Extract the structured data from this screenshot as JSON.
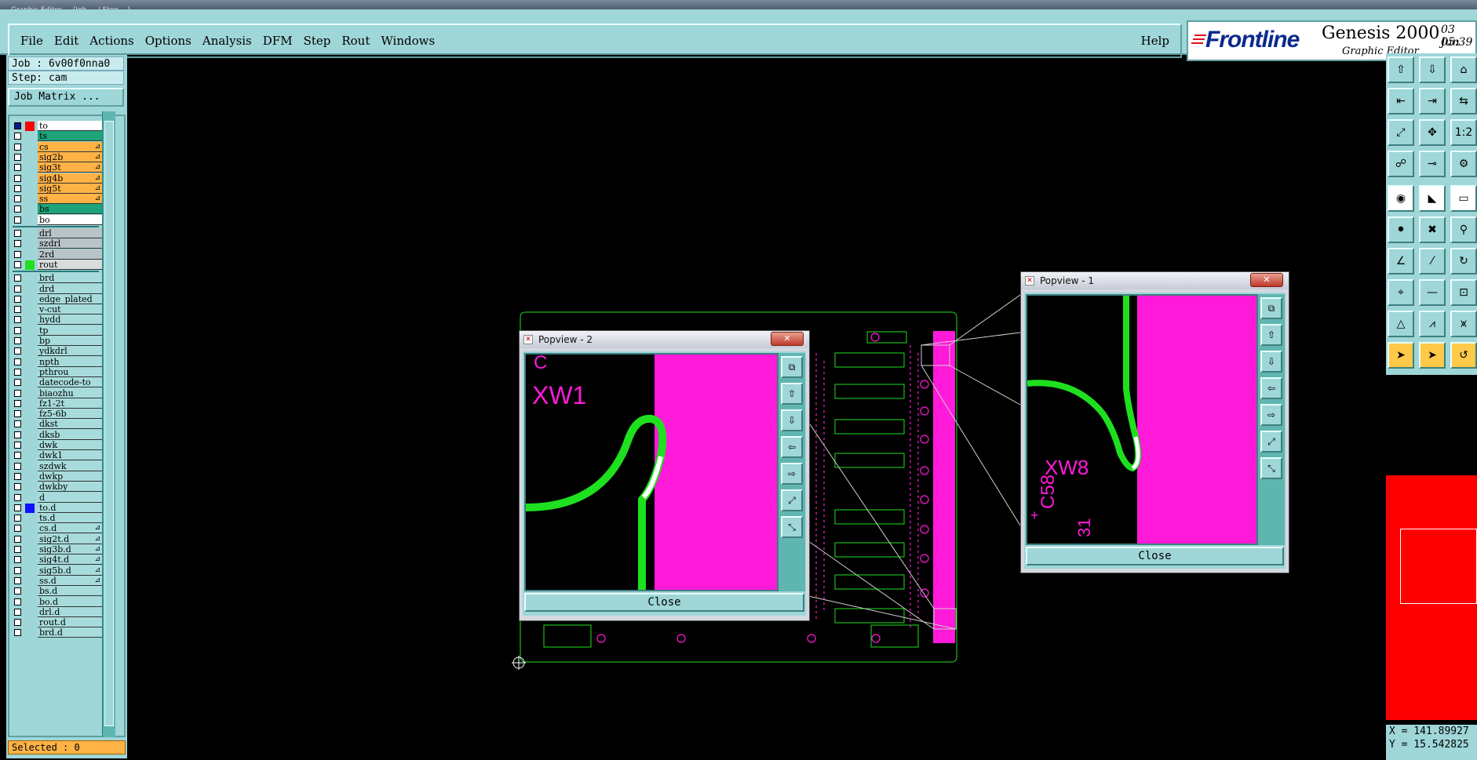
{
  "window": {
    "title": "Graphic Editor ... (Job ... / Step ...)"
  },
  "menubar": {
    "items": [
      "File",
      "Edit",
      "Actions",
      "Options",
      "Analysis",
      "DFM",
      "Step",
      "Rout",
      "Windows"
    ],
    "help": "Help"
  },
  "brand": {
    "logo": "Frontline",
    "product": "Genesis 2000",
    "subtitle": "Graphic Editor",
    "date": "03 Jun",
    "time": "05:39"
  },
  "job": {
    "job_label": "Job : 6v00f0nna0",
    "step_label": "Step: cam",
    "matrix_button": "Job Matrix ..."
  },
  "layers": [
    {
      "name": "to",
      "bg": "#ffffff",
      "swatch": "#ff0000",
      "state": "work"
    },
    {
      "name": "ts",
      "bg": "#1ea37a"
    },
    {
      "name": "cs",
      "bg": "#ffb347",
      "mark": "⊿"
    },
    {
      "name": "sig2b",
      "bg": "#ffb347",
      "mark": "⊿"
    },
    {
      "name": "sig3t",
      "bg": "#ffb347",
      "mark": "⊿"
    },
    {
      "name": "sig4b",
      "bg": "#ffb347",
      "mark": "⊿"
    },
    {
      "name": "sig5t",
      "bg": "#ffb347",
      "mark": "⊿"
    },
    {
      "name": "ss",
      "bg": "#ffb347",
      "mark": "⊿"
    },
    {
      "name": "bs",
      "bg": "#1ea37a"
    },
    {
      "name": "bo",
      "bg": "#ffffff"
    },
    {
      "sep": true
    },
    {
      "name": "drl",
      "bg": "#b8c4c8"
    },
    {
      "name": "szdrl",
      "bg": "#b8c4c8"
    },
    {
      "name": "2rd",
      "bg": "#b8c4c8"
    },
    {
      "name": "rout",
      "bg": "#d8dcdc",
      "swatch": "#1ee01e"
    },
    {
      "sep": true
    },
    {
      "name": "brd",
      "bg": "#a8dcdc"
    },
    {
      "name": "drd",
      "bg": "#a8dcdc"
    },
    {
      "name": "edge_plated",
      "bg": "#a8dcdc"
    },
    {
      "name": "v-cut",
      "bg": "#a8dcdc"
    },
    {
      "name": "hydd",
      "bg": "#a8dcdc"
    },
    {
      "name": "tp",
      "bg": "#a8dcdc"
    },
    {
      "name": "bp",
      "bg": "#a8dcdc"
    },
    {
      "name": "ydkdrl",
      "bg": "#a8dcdc"
    },
    {
      "name": "npth",
      "bg": "#a8dcdc"
    },
    {
      "name": "pthrou",
      "bg": "#a8dcdc"
    },
    {
      "name": "datecode-to",
      "bg": "#a8dcdc"
    },
    {
      "name": "biaozhu",
      "bg": "#a8dcdc"
    },
    {
      "name": "fz1-2t",
      "bg": "#a8dcdc"
    },
    {
      "name": "fz5-6b",
      "bg": "#a8dcdc"
    },
    {
      "name": "dkst",
      "bg": "#a8dcdc"
    },
    {
      "name": "dksb",
      "bg": "#a8dcdc"
    },
    {
      "name": "dwk",
      "bg": "#a8dcdc"
    },
    {
      "name": "dwk1",
      "bg": "#a8dcdc"
    },
    {
      "name": "szdwk",
      "bg": "#a8dcdc"
    },
    {
      "name": "dwkp",
      "bg": "#a8dcdc"
    },
    {
      "name": "dwkby",
      "bg": "#a8dcdc"
    },
    {
      "name": "d",
      "bg": "#a8dcdc"
    },
    {
      "name": "to.d",
      "bg": "#a8dcdc",
      "swatch": "#1010ff"
    },
    {
      "name": "ts.d",
      "bg": "#a8dcdc"
    },
    {
      "name": "cs.d",
      "bg": "#a8dcdc",
      "mark": "⊿"
    },
    {
      "name": "sig2t.d",
      "bg": "#a8dcdc",
      "mark": "⊿"
    },
    {
      "name": "sig3b.d",
      "bg": "#a8dcdc",
      "mark": "⊿"
    },
    {
      "name": "sig4t.d",
      "bg": "#a8dcdc",
      "mark": "⊿"
    },
    {
      "name": "sig5b.d",
      "bg": "#a8dcdc",
      "mark": "⊿"
    },
    {
      "name": "ss.d",
      "bg": "#a8dcdc",
      "mark": "⊿"
    },
    {
      "name": "bs.d",
      "bg": "#a8dcdc"
    },
    {
      "name": "bo.d",
      "bg": "#a8dcdc"
    },
    {
      "name": "drl.d",
      "bg": "#a8dcdc"
    },
    {
      "name": "rout.d",
      "bg": "#a8dcdc"
    },
    {
      "name": "brd.d",
      "bg": "#a8dcdc"
    }
  ],
  "status": {
    "selected": "Selected : 0"
  },
  "coords": {
    "x": "X = 141.89927",
    "y": "Y = 15.542825"
  },
  "popview1": {
    "title": "Popview - 1",
    "close_x": "✕",
    "labels": [
      "XW8",
      "C58",
      "+",
      "31"
    ],
    "close_button": "Close",
    "tools": [
      "zoom-home",
      "pan-up",
      "pan-down",
      "pan-left",
      "pan-right",
      "zoom-in",
      "zoom-out"
    ]
  },
  "popview2": {
    "title": "Popview - 2",
    "close_x": "✕",
    "labels": [
      "XW1",
      "C"
    ],
    "close_button": "Close",
    "tools": [
      "zoom-home",
      "pan-up",
      "pan-down",
      "pan-left",
      "pan-right",
      "zoom-in",
      "zoom-out"
    ]
  },
  "toolbox": [
    [
      "⇧",
      "⇩",
      "⌂"
    ],
    [
      "⇤",
      "⇥",
      "⇆"
    ],
    [
      "⤢",
      "✥",
      "1:2"
    ],
    [
      "☍",
      "⊸",
      "⚙"
    ],
    [
      "◉",
      "◣",
      "▭"
    ],
    [
      "⚫",
      "✖",
      "⚲"
    ],
    [
      "∠",
      "⁄",
      "↻"
    ],
    [
      "⌖",
      "—",
      "⊡"
    ],
    [
      "△",
      "⩘",
      "⩙"
    ],
    [
      "➤",
      "➤",
      "↺"
    ]
  ],
  "colors": {
    "pink": "#ff1ad9",
    "green": "#1ee01e",
    "panel": "#9fd6d8",
    "canvas": "#000000"
  }
}
